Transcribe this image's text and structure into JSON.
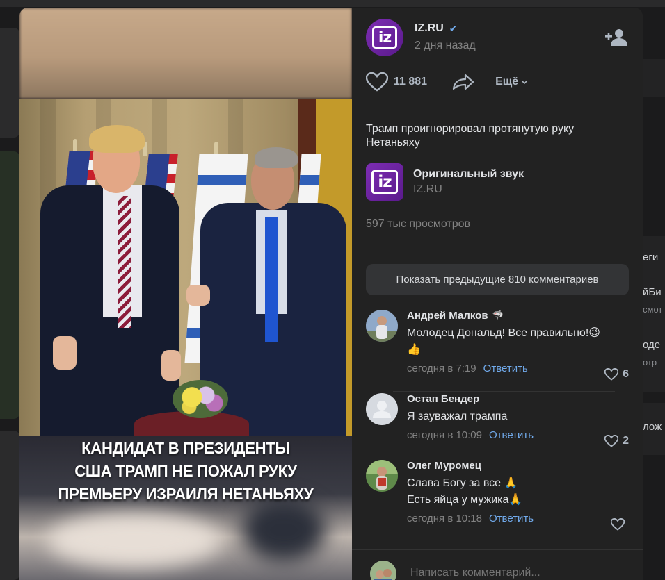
{
  "channel": {
    "name": "IZ.RU",
    "verified": true,
    "posted": "2 дня назад",
    "logo_text": "iz"
  },
  "actions": {
    "likes": "11 881",
    "more_label": "Ещё"
  },
  "video": {
    "caption_lines": [
      "КАНДИДАТ В ПРЕЗИДЕНТЫ",
      "США ТРАМП НЕ ПОЖАЛ РУКУ",
      "ПРЕМЬЕРУ ИЗРАИЛЯ НЕТАНЬЯХУ"
    ]
  },
  "post": {
    "description": "Трамп проигнорировал протянутую руку Нетаньяху",
    "audio_title": "Оригинальный звук",
    "audio_author": "IZ.RU",
    "views": "597 тыс просмотров"
  },
  "comments_section": {
    "show_previous": "Показать предыдущие 810 комментариев",
    "items": [
      {
        "author": "Андрей Малков",
        "author_badge": "🦈",
        "text_lines": [
          "Молодец Дональд! Все правильно!😉",
          "👍"
        ],
        "time": "сегодня в 7:19",
        "reply": "Ответить",
        "likes": "6"
      },
      {
        "author": "Остап Бендер",
        "text_lines": [
          "Я зауважал трампа"
        ],
        "time": "сегодня в 10:09",
        "reply": "Ответить",
        "likes": "2"
      },
      {
        "author": "Олег Муромец",
        "text_lines": [
          "Слава Богу за все 🙏",
          "Есть яйца у мужика🙏"
        ],
        "time": "сегодня в 10:18",
        "reply": "Ответить",
        "likes": ""
      }
    ],
    "compose_placeholder": "Написать комментарий..."
  },
  "background": {
    "right_snippets": [
      "еги",
      "йБи",
      "смот",
      "оде",
      "отр",
      "лож"
    ]
  },
  "colors": {
    "accent": "#71aaeb",
    "brand": "#7d2db3",
    "panel_bg": "#222222",
    "secondary_text": "#828282"
  }
}
